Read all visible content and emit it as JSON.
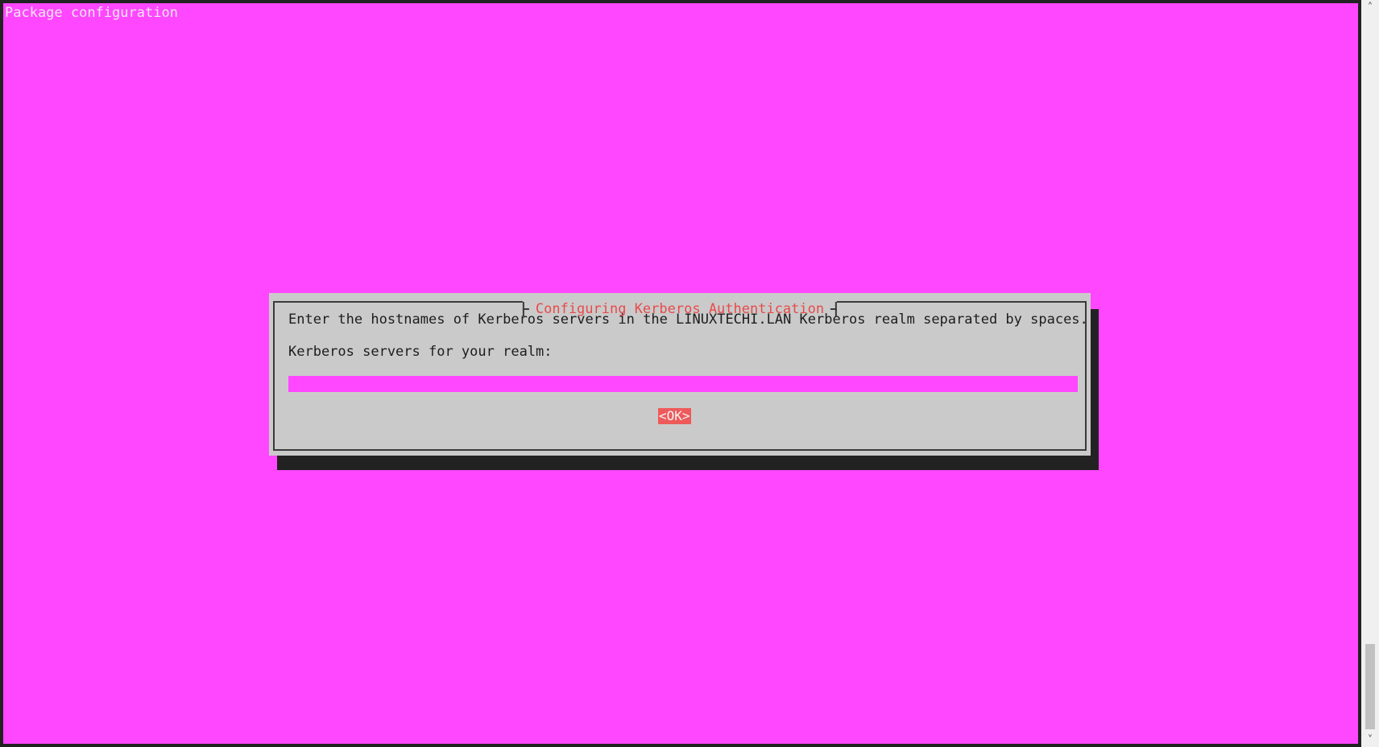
{
  "terminal": {
    "backtitle": "Package configuration"
  },
  "dialog": {
    "title": "Configuring Kerberos Authentication",
    "prompt": "Enter the hostnames of Kerberos servers in the LINUXTECHI.LAN Kerberos realm separated by spaces.",
    "label": "Kerberos servers for your realm:",
    "input_value": "",
    "ok_label": "<OK>"
  },
  "scrollbar": {
    "up_icon": "chevron-up-icon",
    "down_icon": "chevron-down-icon"
  },
  "colors": {
    "background": "#ff47ff",
    "dialog": "#cacaca",
    "title": "#e84b4b",
    "ok_button": "#ee5a5a"
  }
}
